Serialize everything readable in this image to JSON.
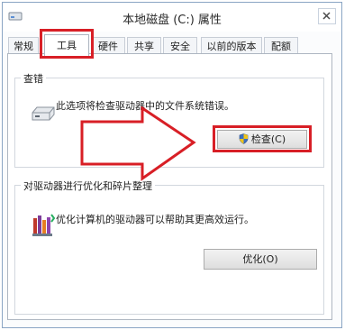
{
  "window": {
    "title": "本地磁盘 (C:) 属性",
    "app_icon": "drive-icon",
    "close_icon": "close-icon"
  },
  "tabs": [
    {
      "label": "常规",
      "active": false
    },
    {
      "label": "工具",
      "active": true
    },
    {
      "label": "硬件",
      "active": false
    },
    {
      "label": "共享",
      "active": false
    },
    {
      "label": "安全",
      "active": false
    },
    {
      "label": "以前的版本",
      "active": false
    },
    {
      "label": "配额",
      "active": false
    }
  ],
  "error_checking": {
    "title": "查错",
    "description": "此选项将检查驱动器中的文件系统错误。",
    "button_label": "检查(C)",
    "button_icon": "shield-icon",
    "group_icon": "drive-icon"
  },
  "optimize": {
    "title": "对驱动器进行优化和碎片整理",
    "description": "优化计算机的驱动器可以帮助其更高效运行。",
    "button_label": "优化(O)",
    "group_icon": "defrag-icon"
  },
  "annotations": {
    "highlight_color": "#d81f26",
    "arrow_icon": "right-arrow-icon"
  }
}
